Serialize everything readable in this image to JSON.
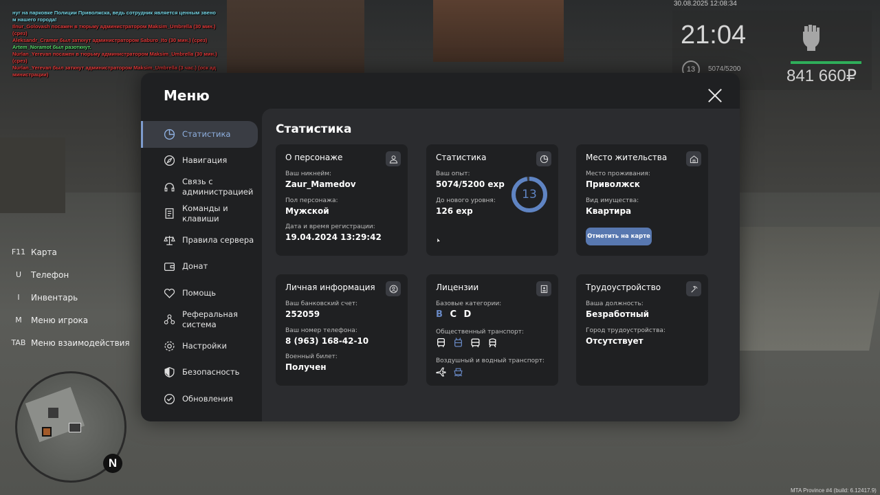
{
  "chat": [
    {
      "text": "нуг на парковке Полиции Приволжска, ведь сотрудник является ценным звено",
      "color": "cyan"
    },
    {
      "text": "м нашего города!",
      "color": "cyan"
    },
    {
      "text": "Ilnur_Golovash посажен в тюрьму администратором Maksim_Umbrella (30 мин.)",
      "color": "red"
    },
    {
      "text": "(срез)",
      "color": "red"
    },
    {
      "text": "Aleksandr_Cramer был заткнут администратором Saburo_Ito (30 мин.) (срез)",
      "color": "red"
    },
    {
      "text": "Artem_Noramot был разоткнут.",
      "color": "green"
    },
    {
      "text": "Nurlan_Yerevan посажен в тюрьму администратором Maksim_Umbrella (30 мин.)",
      "color": "red"
    },
    {
      "text": "(срез)",
      "color": "red"
    },
    {
      "text": "Nurlan_Yerevan был заткнут администратором Maksim_Umbrella (3 час.) (оск ад",
      "color": "red"
    },
    {
      "text": "министрации)",
      "color": "red"
    }
  ],
  "hud": {
    "datetime": "30.08.2025 12:08:34",
    "time": "21:04",
    "level": "13",
    "exp": "5074/5200",
    "money": "841 660₽"
  },
  "keys": [
    {
      "key": "F11",
      "label": "Карта"
    },
    {
      "key": "U",
      "label": "Телефон"
    },
    {
      "key": "I",
      "label": "Инвентарь"
    },
    {
      "key": "M",
      "label": "Меню игрока"
    },
    {
      "key": "TAB",
      "label": "Меню взаимодействия"
    }
  ],
  "minimap": {
    "north": "N"
  },
  "build": "MTA Province #4 (build: 6.12417.9)",
  "menu": {
    "title": "Меню",
    "sidebar": [
      {
        "label": "Статистика",
        "icon": "chart-pie-icon",
        "active": true
      },
      {
        "label": "Навигация",
        "icon": "compass-icon"
      },
      {
        "label": "Связь с администрацией",
        "icon": "headset-icon"
      },
      {
        "label": "Команды и клавиши",
        "icon": "document-icon"
      },
      {
        "label": "Правила сервера",
        "icon": "scales-icon"
      },
      {
        "label": "Донат",
        "icon": "wallet-icon"
      },
      {
        "label": "Помощь",
        "icon": "handshake-heart-icon"
      },
      {
        "label": "Реферальная система",
        "icon": "network-icon"
      },
      {
        "label": "Настройки",
        "icon": "gear-icon"
      },
      {
        "label": "Безопасность",
        "icon": "shield-icon"
      },
      {
        "label": "Обновления",
        "icon": "check-circle-icon"
      }
    ],
    "content_title": "Статистика",
    "cards": {
      "character": {
        "title": "О персонаже",
        "nick_label": "Ваш никнейм:",
        "nick": "Zaur_Mamedov",
        "gender_label": "Пол персонажа:",
        "gender": "Мужской",
        "reg_label": "Дата и время регистрации:",
        "reg": "19.04.2024 13:29:42"
      },
      "stats": {
        "title": "Статистика",
        "exp_label": "Ваш опыт:",
        "exp": "5074/5200 exp",
        "next_label": "До нового уровня:",
        "next": "126 exp",
        "level": "13",
        "level_progress": 0.976
      },
      "residence": {
        "title": "Место жительства",
        "place_label": "Место проживания:",
        "place": "Приволжск",
        "property_label": "Вид имущества:",
        "property": "Квартира",
        "button": "Отметить на карте"
      },
      "personal": {
        "title": "Личная информация",
        "bank_label": "Ваш банковский счет:",
        "bank": "252059",
        "phone_label": "Ваш номер телефона:",
        "phone": "8 (963) 168-42-10",
        "military_label": "Военный билет:",
        "military": "Получен"
      },
      "licenses": {
        "title": "Лицензии",
        "basic_label": "Базовые категории:",
        "categories": [
          {
            "letter": "B",
            "owned": true
          },
          {
            "letter": "C",
            "owned": false
          },
          {
            "letter": "D",
            "owned": false
          }
        ],
        "public_label": "Общественный транспорт:",
        "air_label": "Воздушный и водный транспорт:"
      },
      "job": {
        "title": "Трудоустройство",
        "position_label": "Ваша должность:",
        "position": "Безработный",
        "city_label": "Город трудоустройства:",
        "city": "Отсутствует"
      }
    }
  },
  "colors": {
    "accent": "#5878b0",
    "active_text": "#8fb0e0",
    "card_bg": "#1f2022",
    "content_bg": "#2b2c2f"
  }
}
